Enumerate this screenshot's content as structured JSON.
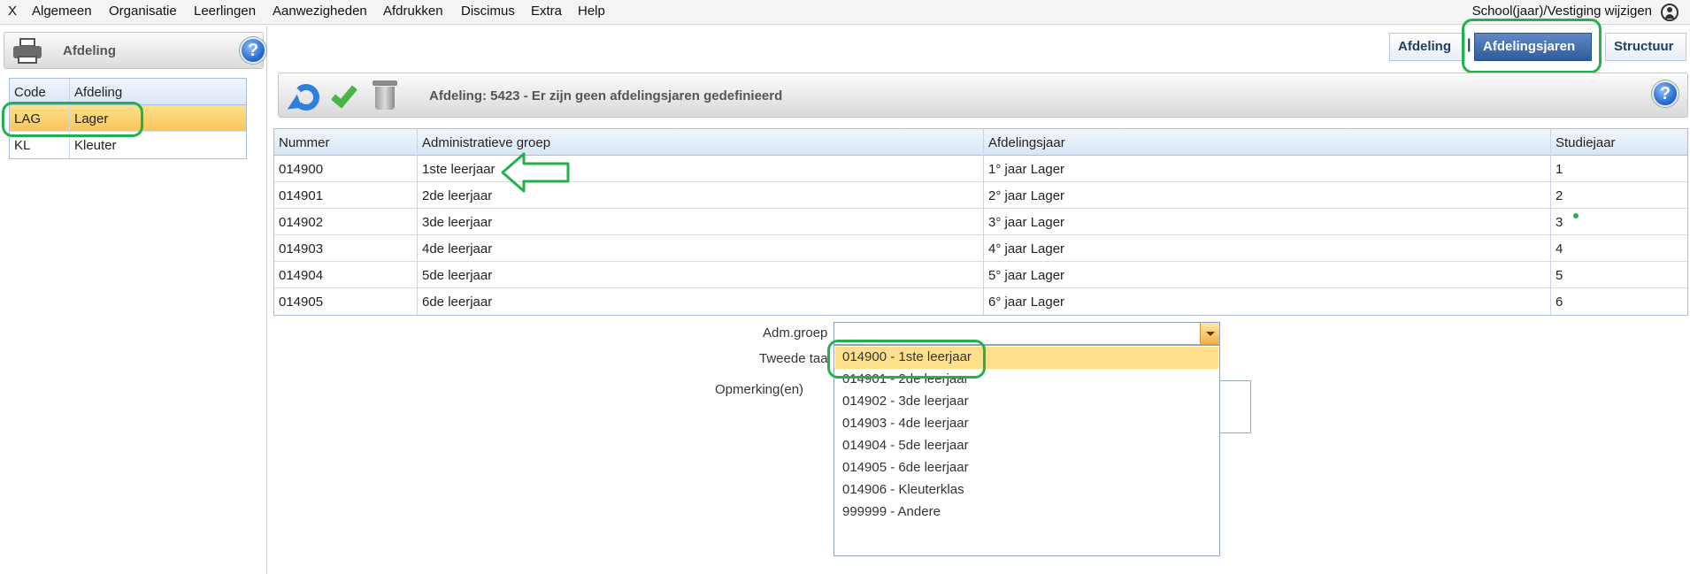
{
  "menu": {
    "close": "X",
    "items": [
      "Algemeen",
      "Organisatie",
      "Leerlingen",
      "Aanwezigheden",
      "Afdrukken",
      "Discimus",
      "Extra",
      "Help"
    ],
    "school_link": "School(jaar)/Vestiging wijzigen"
  },
  "left_panel": {
    "title": "Afdeling",
    "help": "?",
    "table": {
      "headers": [
        "Code",
        "Afdeling"
      ],
      "rows": [
        {
          "code": "LAG",
          "name": "Lager",
          "selected": true
        },
        {
          "code": "KL",
          "name": "Kleuter",
          "selected": false
        }
      ]
    }
  },
  "tabs": {
    "afdeling": "Afdeling",
    "separator": "|",
    "afdelingsjaren": "Afdelingsjaren",
    "structuur": "Structuur"
  },
  "toolbar": {
    "title": "Afdeling: 5423 - Er zijn geen afdelingsjaren gedefinieerd",
    "help": "?"
  },
  "main_table": {
    "headers": [
      "Nummer",
      "Administratieve groep",
      "Afdelingsjaar",
      "Studiejaar"
    ],
    "rows": [
      [
        "014900",
        "1ste leerjaar",
        "1° jaar Lager",
        "1"
      ],
      [
        "014901",
        "2de leerjaar",
        "2° jaar Lager",
        "2"
      ],
      [
        "014902",
        "3de leerjaar",
        "3° jaar Lager",
        "3"
      ],
      [
        "014903",
        "4de leerjaar",
        "4° jaar Lager",
        "4"
      ],
      [
        "014904",
        "5de leerjaar",
        "5° jaar Lager",
        "5"
      ],
      [
        "014905",
        "6de leerjaar",
        "6° jaar Lager",
        "6"
      ]
    ]
  },
  "form": {
    "adm_groep_label": "Adm.groep",
    "adm_groep_value": "",
    "tweede_taal_label": "Tweede taa",
    "opmerking_label": "Opmerking(en)"
  },
  "dropdown": {
    "options": [
      "014900 - 1ste leerjaar",
      "014901 - 2de leerjaar",
      "014902 - 3de leerjaar",
      "014903 - 4de leerjaar",
      "014904 - 5de leerjaar",
      "014905 - 6de leerjaar",
      "014906 - Kleuterklas",
      "999999 - Andere"
    ],
    "selected_index": 0
  },
  "colors": {
    "annotation": "#22b14c",
    "selection": "#ffe08a",
    "active_tab": "#2f5b9c"
  }
}
